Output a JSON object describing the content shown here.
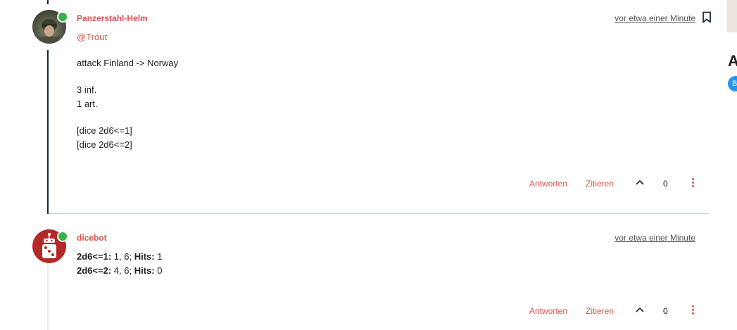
{
  "posts": [
    {
      "username": "Panzerstahl-Helm",
      "timestamp": "vor etwa einer Minute",
      "mention": "@Trout",
      "lines": [
        "attack Finland -> Norway",
        "3 inf.",
        "1 art.",
        "[dice 2d6<=1]",
        "[dice 2d6<=2]"
      ],
      "actions": {
        "reply": "Antworten",
        "quote": "Zitieren",
        "votes": "0"
      },
      "icons": {
        "avatar": "soldier-avatar",
        "bookmark": "bookmark-icon",
        "upvote": "chevron-up-icon",
        "more": "vertical-dots-icon"
      }
    },
    {
      "username": "dicebot",
      "timestamp": "vor etwa einer Minute",
      "results": [
        {
          "label": "2d6<=1:",
          "rolls": " 1, 6; ",
          "hits_label": "Hits:",
          "hits": " 1"
        },
        {
          "label": "2d6<=2:",
          "rolls": " 4, 6; ",
          "hits_label": "Hits:",
          "hits": " 0"
        }
      ],
      "actions": {
        "reply": "Antworten",
        "quote": "Zitieren",
        "votes": "0"
      },
      "icons": {
        "avatar": "dice-robot-avatar",
        "upvote": "chevron-up-icon",
        "more": "vertical-dots-icon"
      }
    }
  ],
  "sidebar": {
    "letter": "A",
    "badge": "B"
  },
  "colors": {
    "accent": "#d9534f",
    "online": "#2fb34a",
    "thread": "#1d2c3a",
    "badge": "#2196f3"
  }
}
